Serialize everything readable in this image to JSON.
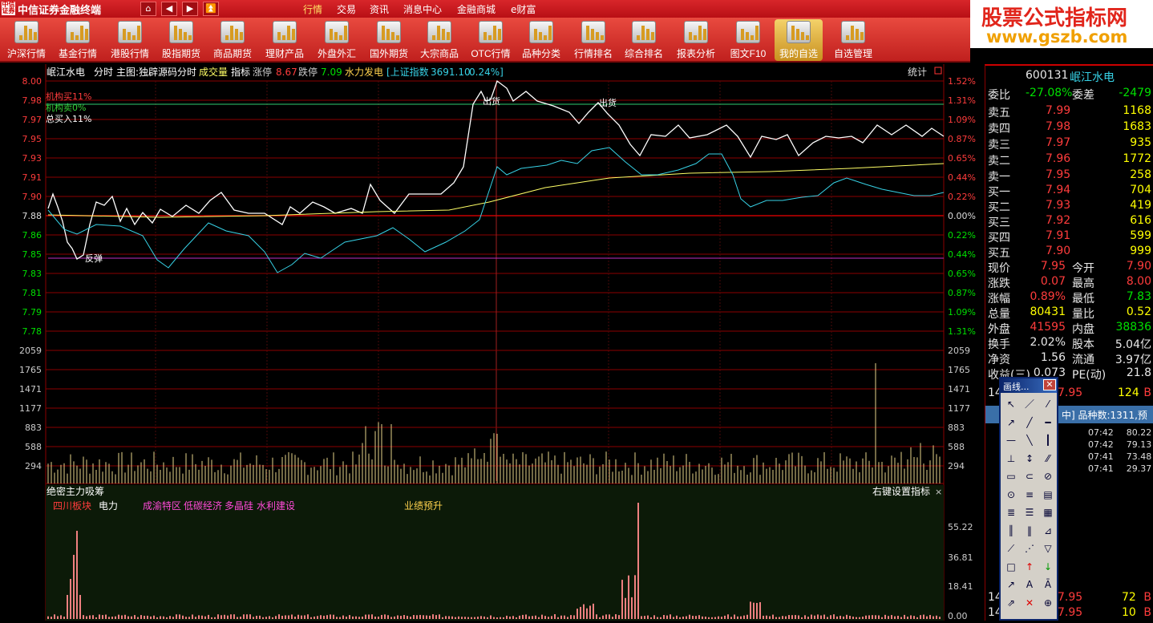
{
  "app": {
    "title": "中信证券金融终端",
    "logo": "中信证券"
  },
  "nav": {
    "home": "⌂",
    "back": "◀",
    "forward": "▶",
    "up": "⏫"
  },
  "menu": [
    "行情",
    "交易",
    "资讯",
    "消息中心",
    "金融商城",
    "e财富"
  ],
  "watermark": {
    "line1": "股票公式指标网",
    "line2": "www.gszb.com"
  },
  "toolbar": [
    "沪深行情",
    "基金行情",
    "港股行情",
    "股指期货",
    "商品期货",
    "理财产品",
    "外盘外汇",
    "国外期货",
    "大宗商品",
    "OTC行情",
    "品种分类",
    "行情排名",
    "综合排名",
    "报表分析",
    "图文F10",
    "我的自选",
    "自选管理"
  ],
  "chart_header": {
    "stock": "岷江水电",
    "mode": "分时",
    "main": "主图:独辟源码分时",
    "vol": "成交量",
    "ind": "指标",
    "up_label": "涨停",
    "up_val": "8.67",
    "down_label": "跌停",
    "down_val": "7.09",
    "sector": "水力发电",
    "index_label": "[上证指数",
    "index_val": "3691.10",
    "index_pct": "0.24%]",
    "stats": "统计"
  },
  "legend": {
    "l1": "机构买11%",
    "l2": "机构卖0%",
    "l3": "总买入11%"
  },
  "annot": {
    "a1": "出货",
    "a2": "出货",
    "a3": "反弹"
  },
  "price_ticks": [
    "8.00",
    "7.98",
    "7.97",
    "7.95",
    "7.93",
    "7.91",
    "7.90",
    "7.88",
    "7.86",
    "7.85",
    "7.83",
    "7.81",
    "7.79",
    "7.78"
  ],
  "pct_ticks": [
    "1.52%",
    "1.31%",
    "1.09%",
    "0.87%",
    "0.65%",
    "0.44%",
    "0.22%",
    "0.00%",
    "0.22%",
    "0.44%",
    "0.65%",
    "0.87%",
    "1.09%",
    "1.31%"
  ],
  "vol_ticks": [
    "2059",
    "1765",
    "1471",
    "1177",
    "883",
    "588",
    "294"
  ],
  "sub": {
    "title": "绝密主力吸筹",
    "hint": "右键设置指标",
    "tags": [
      "四川板块",
      "电力",
      "成渝特区",
      "低碳经济",
      "多晶硅",
      "水利建设",
      "业绩预升"
    ],
    "ticks": [
      "55.22",
      "36.81",
      "18.41",
      "0.00"
    ]
  },
  "colors": {
    "up": "#ff3c3c",
    "down": "#00e000",
    "grid": "#8b0000",
    "price": "#ffffff",
    "avg": "#ffff66",
    "flow": "#37d2e6"
  },
  "quote": {
    "code": "600131",
    "name": "岷江水电",
    "wb": {
      "label": "委比",
      "val": "-27.08%",
      "label2": "委差",
      "val2": "-2479"
    },
    "asks": [
      {
        "l": "卖五",
        "p": "7.99",
        "v": "1168"
      },
      {
        "l": "卖四",
        "p": "7.98",
        "v": "1683"
      },
      {
        "l": "卖三",
        "p": "7.97",
        "v": "935"
      },
      {
        "l": "卖二",
        "p": "7.96",
        "v": "1772"
      },
      {
        "l": "卖一",
        "p": "7.95",
        "v": "258"
      }
    ],
    "bids": [
      {
        "l": "买一",
        "p": "7.94",
        "v": "704"
      },
      {
        "l": "买二",
        "p": "7.93",
        "v": "419"
      },
      {
        "l": "买三",
        "p": "7.92",
        "v": "616"
      },
      {
        "l": "买四",
        "p": "7.91",
        "v": "599"
      },
      {
        "l": "买五",
        "p": "7.90",
        "v": "999"
      }
    ],
    "stats": [
      {
        "l1": "现价",
        "v1": "7.95",
        "l2": "今开",
        "v2": "7.90"
      },
      {
        "l1": "涨跌",
        "v1": "0.07",
        "l2": "最高",
        "v2": "8.00"
      },
      {
        "l1": "涨幅",
        "v1": "0.89%",
        "l2": "最低",
        "v2": "7.83"
      },
      {
        "l1": "总量",
        "v1": "80431",
        "l2": "量比",
        "v2": "0.52"
      },
      {
        "l1": "外盘",
        "v1": "41595",
        "l2": "内盘",
        "v2": "38836"
      },
      {
        "l1": "换手",
        "v1": "2.02%",
        "l2": "股本",
        "v2": "5.04亿"
      },
      {
        "l1": "净资",
        "v1": "1.56",
        "l2": "流通",
        "v2": "3.97亿"
      },
      {
        "l1": "收益(三)",
        "v1": "0.073",
        "l2": "PE(动)",
        "v2": "21.8"
      }
    ],
    "tick_row": {
      "t": "14",
      "p": "7.95",
      "v": "124",
      "s": "B"
    },
    "list_header": "中] 品种数:1311,预",
    "list": [
      {
        "t": "07:42",
        "v": "80.22"
      },
      {
        "t": "07:42",
        "v": "79.13"
      },
      {
        "t": "07:41",
        "v": "73.48"
      },
      {
        "t": "07:41",
        "v": "29.37"
      }
    ],
    "bottom": [
      {
        "t": "14",
        "p": "7.95",
        "v": "72",
        "s": "B"
      },
      {
        "t": "14",
        "p": "7.95",
        "v": "10",
        "s": "B"
      }
    ]
  },
  "draw": {
    "title": "画线...",
    "close": "✕"
  }
}
